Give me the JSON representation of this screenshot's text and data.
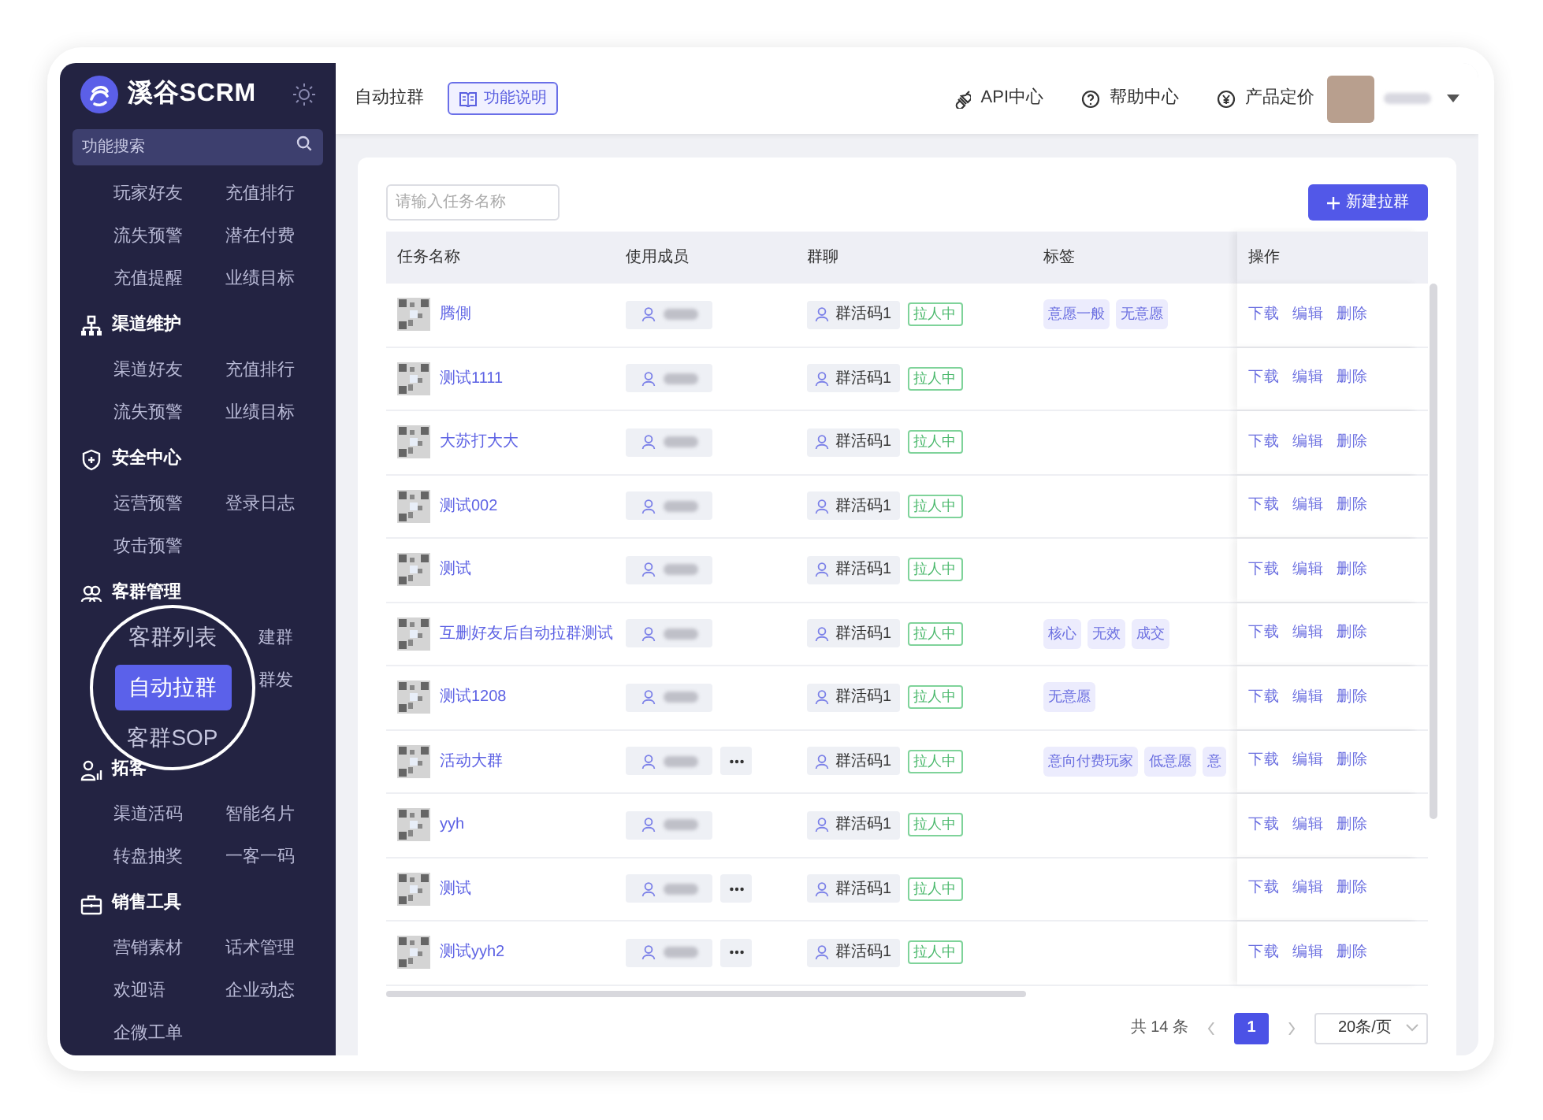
{
  "sidebar": {
    "logo": "溪谷SCRM",
    "search": {
      "placeholder": "功能搜索"
    },
    "groups": [
      {
        "items": [
          {
            "label": "玩家好友"
          },
          {
            "label": "充值排行"
          },
          {
            "label": "流失预警"
          },
          {
            "label": "潜在付费"
          },
          {
            "label": "充值提醒"
          },
          {
            "label": "业绩目标"
          }
        ]
      },
      {
        "kind": "channel",
        "title": "渠道维护",
        "items": [
          {
            "label": "渠道好友"
          },
          {
            "label": "充值排行"
          },
          {
            "label": "流失预警"
          },
          {
            "label": "业绩目标"
          }
        ]
      },
      {
        "kind": "security",
        "title": "安全中心",
        "items": [
          {
            "label": "运营预警"
          },
          {
            "label": "登录日志"
          },
          {
            "label": "攻击预警"
          }
        ]
      },
      {
        "kind": "customers",
        "title": "客群管理",
        "items": [
          {
            "label": "建群"
          },
          {
            "label": "群发"
          }
        ]
      },
      {
        "kind": "acquire",
        "title": "拓客",
        "items": [
          {
            "label": "渠道活码"
          },
          {
            "label": "智能名片"
          },
          {
            "label": "转盘抽奖"
          },
          {
            "label": "一客一码"
          }
        ]
      },
      {
        "kind": "sales",
        "title": "销售工具",
        "items": [
          {
            "label": "营销素材"
          },
          {
            "label": "话术管理"
          },
          {
            "label": "欢迎语"
          },
          {
            "label": "企业动态"
          },
          {
            "label": "企微工单"
          }
        ]
      }
    ]
  },
  "magnifier": {
    "items": [
      {
        "label": "客群列表",
        "selected": false
      },
      {
        "label": "自动拉群",
        "selected": true
      },
      {
        "label": "客群SOP",
        "selected": false
      }
    ]
  },
  "header": {
    "breadcrumb": "自动拉群",
    "help_button": "功能说明",
    "links": [
      {
        "kind": "api",
        "label": "API中心"
      },
      {
        "kind": "help",
        "label": "帮助中心"
      },
      {
        "kind": "price",
        "label": "产品定价"
      }
    ]
  },
  "toolbar": {
    "search": {
      "placeholder": "请输入任务名称"
    },
    "new_button": "新建拉群"
  },
  "table": {
    "columns": [
      "任务名称",
      "使用成员",
      "群聊",
      "标签",
      "操作"
    ],
    "rows": [
      {
        "name": "腾側",
        "more": false,
        "group": "群活码1",
        "status": "拉人中",
        "tags": [
          "意愿一般",
          "无意愿"
        ]
      },
      {
        "name": "测试1111",
        "more": false,
        "group": "群活码1",
        "status": "拉人中",
        "tags": []
      },
      {
        "name": "大苏打大大",
        "more": false,
        "group": "群活码1",
        "status": "拉人中",
        "tags": []
      },
      {
        "name": "测试002",
        "more": false,
        "group": "群活码1",
        "status": "拉人中",
        "tags": []
      },
      {
        "name": "测试",
        "more": false,
        "group": "群活码1",
        "status": "拉人中",
        "tags": []
      },
      {
        "name": "互删好友后自动拉群测试",
        "more": false,
        "group": "群活码1",
        "status": "拉人中",
        "tags": [
          "核心",
          "无效",
          "成交"
        ]
      },
      {
        "name": "测试1208",
        "more": false,
        "group": "群活码1",
        "status": "拉人中",
        "tags": [
          "无意愿"
        ]
      },
      {
        "name": "活动大群",
        "more": true,
        "group": "群活码1",
        "status": "拉人中",
        "tags": [
          "意向付费玩家",
          "低意愿",
          "意"
        ]
      },
      {
        "name": "yyh",
        "more": false,
        "group": "群活码1",
        "status": "拉人中",
        "tags": []
      },
      {
        "name": "测试",
        "more": true,
        "group": "群活码1",
        "status": "拉人中",
        "tags": []
      },
      {
        "name": "测试yyh2",
        "more": true,
        "group": "群活码1",
        "status": "拉人中",
        "tags": []
      }
    ],
    "row_actions": [
      [
        "下载",
        "编辑",
        "删除"
      ],
      [
        "下载",
        "编辑",
        "删除"
      ],
      [
        "下载",
        "编辑",
        "删除"
      ],
      [
        "下载",
        "编辑",
        "删除"
      ],
      [
        "下载",
        "编辑",
        "删除"
      ],
      [
        "下载",
        "编辑",
        "删除"
      ],
      [
        "下载",
        "编辑",
        "删除"
      ],
      [
        "下载",
        "编辑",
        "删除"
      ],
      [
        "下载",
        "编辑",
        "删除"
      ],
      [
        "下载",
        "编辑",
        "删除"
      ],
      [
        "下载",
        "编辑",
        "删除"
      ]
    ]
  },
  "pagination": {
    "total": "共 14 条",
    "pages": [
      {
        "label": "1",
        "selected": true
      }
    ],
    "page_size": "20条/页"
  }
}
